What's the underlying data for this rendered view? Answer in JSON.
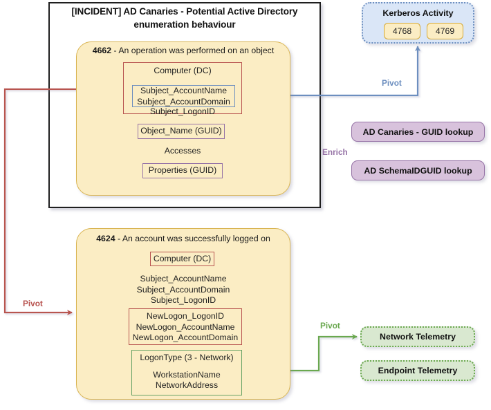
{
  "incident": {
    "title_line1": "[INCIDENT] AD Canaries - Potential Active Directory",
    "title_line2": "enumeration behaviour"
  },
  "events": [
    {
      "id": "4662",
      "separator": " - ",
      "description": "An operation was performed on an object",
      "heading": "4662 - An operation was performed on an object",
      "fields": [
        {
          "name": "computer-dc",
          "border": "red",
          "lines": [
            "Computer (DC)"
          ]
        },
        {
          "name": "subject-account",
          "border": "blue",
          "lines": [
            "Subject_AccountName",
            "Subject_AccountDomain"
          ]
        },
        {
          "name": "subject-logonid",
          "border": "none",
          "lines": [
            "Subject_LogonID"
          ]
        },
        {
          "name": "object-name-guid",
          "border": "purple",
          "lines": [
            "Object_Name (GUID)"
          ]
        },
        {
          "name": "accesses",
          "border": "none",
          "lines": [
            "Accesses"
          ]
        },
        {
          "name": "properties-guid",
          "border": "purple",
          "lines": [
            "Properties (GUID)"
          ]
        }
      ]
    },
    {
      "id": "4624",
      "separator": " - ",
      "description": "An account was successfully logged on",
      "heading": "4624 - An account was successfully logged on",
      "fields": [
        {
          "name": "computer-dc",
          "border": "red",
          "lines": [
            "Computer (DC)"
          ]
        },
        {
          "name": "subject-details",
          "border": "none",
          "lines": [
            "Subject_AccountName",
            "Subject_AccountDomain",
            "Subject_LogonID"
          ]
        },
        {
          "name": "newlogon-details",
          "border": "red",
          "lines": [
            "NewLogon_LogonID",
            "NewLogon_AccountName",
            "NewLogon_AccountDomain"
          ]
        },
        {
          "name": "logontype-network",
          "border": "green",
          "lines": [
            "LogonType (3 - Network)",
            "",
            "WorkstationName",
            "NetworkAddress"
          ]
        }
      ]
    }
  ],
  "kerberos": {
    "title": "Kerberos Activity",
    "event_ids": [
      "4768",
      "4769"
    ]
  },
  "lookups": [
    {
      "label": "AD Canaries - GUID lookup"
    },
    {
      "label": "AD SchemaIDGUID lookup"
    }
  ],
  "telemetry": [
    {
      "label": "Network Telemetry"
    },
    {
      "label": "Endpoint Telemetry"
    }
  ],
  "edge_labels": {
    "pivot_kerberos": "Pivot",
    "pivot_4624": "Pivot",
    "enrich": "Enrich",
    "pivot_telemetry": "Pivot"
  },
  "colors": {
    "red": "#b85450",
    "blue": "#6c8ebf",
    "purple": "#9673a6",
    "green": "#6aa84f",
    "yellow_fill": "#fbedc4",
    "yellow_border": "#d9b451",
    "kerberos_fill": "#dae6f7",
    "lookup_fill": "#d8c2dc",
    "telemetry_fill": "#d9e8d0",
    "frame_border": "#1f1f1f"
  }
}
